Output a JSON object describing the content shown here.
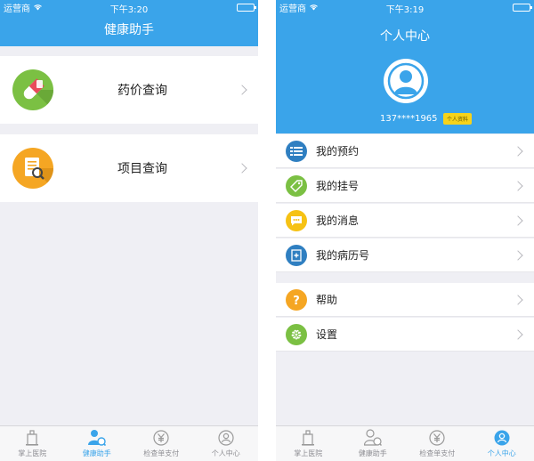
{
  "left": {
    "status": {
      "carrier": "运营商",
      "time": "下午3:20"
    },
    "title": "健康助手",
    "cards": [
      {
        "label": "药价查询",
        "icon": "pill-icon"
      },
      {
        "label": "项目查询",
        "icon": "document-search-icon"
      }
    ],
    "active_tab": 1
  },
  "right": {
    "status": {
      "carrier": "运营商",
      "time": "下午3:19"
    },
    "title": "个人中心",
    "phone": "137****1965",
    "profile_badge": "个人资料",
    "menu": [
      {
        "label": "我的预约",
        "icon": "list-icon"
      },
      {
        "label": "我的挂号",
        "icon": "tag-icon"
      },
      {
        "label": "我的消息",
        "icon": "message-icon"
      },
      {
        "label": "我的病历号",
        "icon": "medical-record-icon"
      }
    ],
    "menu2": [
      {
        "label": "帮助",
        "icon": "help-icon"
      },
      {
        "label": "设置",
        "icon": "gear-icon"
      }
    ],
    "active_tab": 3
  },
  "tabs": [
    {
      "label": "掌上医院",
      "icon": "hospital-icon"
    },
    {
      "label": "健康助手",
      "icon": "health-assistant-icon"
    },
    {
      "label": "检查单支付",
      "icon": "yuan-icon"
    },
    {
      "label": "个人中心",
      "icon": "person-icon"
    }
  ],
  "colors": {
    "brand": "#3aa4ea",
    "pill": "#7bc043",
    "doc": "#f5a623",
    "badge": "#f6d31b"
  }
}
